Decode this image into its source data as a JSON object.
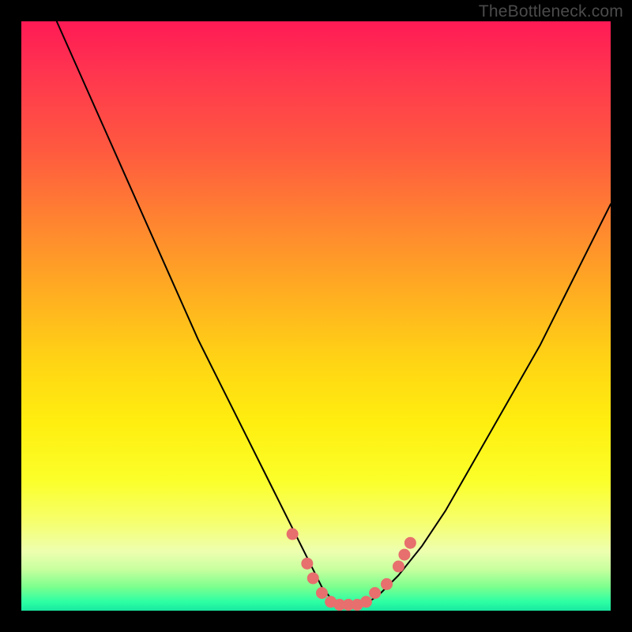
{
  "watermark": "TheBottleneck.com",
  "chart_data": {
    "type": "line",
    "title": "",
    "xlabel": "",
    "ylabel": "",
    "xlim": [
      0,
      100
    ],
    "ylim": [
      0,
      100
    ],
    "series": [
      {
        "name": "bottleneck-curve",
        "x": [
          6,
          10,
          14,
          18,
          22,
          26,
          30,
          34,
          38,
          42,
          46,
          49,
          51,
          53,
          55,
          57,
          59,
          61,
          64,
          68,
          72,
          76,
          80,
          84,
          88,
          92,
          96,
          100
        ],
        "values": [
          100,
          91,
          82,
          73,
          64,
          55,
          46,
          38,
          30,
          22,
          14,
          8,
          4,
          1.5,
          1,
          1,
          1.5,
          3,
          6,
          11,
          17,
          24,
          31,
          38,
          45,
          53,
          61,
          69
        ]
      }
    ],
    "markers": [
      {
        "x": 46.0,
        "y": 13.0
      },
      {
        "x": 48.5,
        "y": 8.0
      },
      {
        "x": 49.5,
        "y": 5.5
      },
      {
        "x": 51.0,
        "y": 3.0
      },
      {
        "x": 52.5,
        "y": 1.5
      },
      {
        "x": 54.0,
        "y": 1.0
      },
      {
        "x": 55.5,
        "y": 1.0
      },
      {
        "x": 57.0,
        "y": 1.0
      },
      {
        "x": 58.5,
        "y": 1.5
      },
      {
        "x": 60.0,
        "y": 3.0
      },
      {
        "x": 62.0,
        "y": 4.5
      },
      {
        "x": 64.0,
        "y": 7.5
      },
      {
        "x": 65.0,
        "y": 9.5
      },
      {
        "x": 66.0,
        "y": 11.5
      }
    ],
    "colors": {
      "curve": "#000000",
      "marker": "#e76f6d"
    }
  }
}
